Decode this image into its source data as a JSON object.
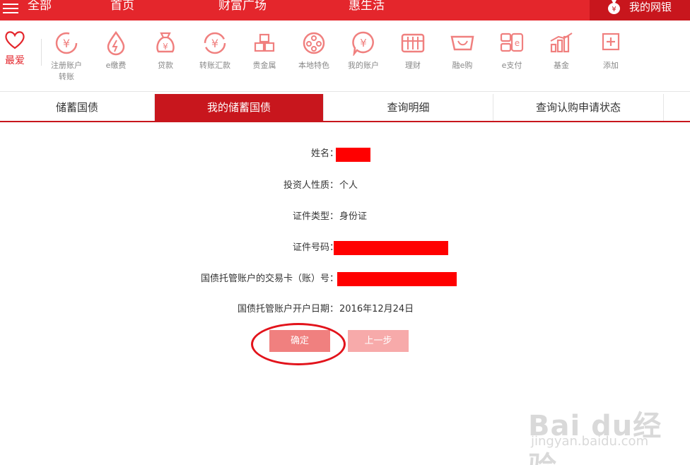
{
  "nav": {
    "all": "全部",
    "home": "首页",
    "wealth": "财富广场",
    "life": "惠生活",
    "mybank": "我的网银"
  },
  "toolbar": {
    "fav_label": "最爱",
    "items": [
      {
        "label": "注册账户\n转账",
        "icon": "register-transfer-icon"
      },
      {
        "label": "e缴费",
        "icon": "e-payment-icon"
      },
      {
        "label": "贷款",
        "icon": "loan-icon"
      },
      {
        "label": "转账汇款",
        "icon": "transfer-icon"
      },
      {
        "label": "贵金属",
        "icon": "precious-metal-icon"
      },
      {
        "label": "本地特色",
        "icon": "local-feature-icon"
      },
      {
        "label": "我的账户",
        "icon": "my-account-icon"
      },
      {
        "label": "理财",
        "icon": "wealth-management-icon"
      },
      {
        "label": "融e购",
        "icon": "e-shop-icon"
      },
      {
        "label": "e支付",
        "icon": "e-pay-icon"
      },
      {
        "label": "基金",
        "icon": "fund-icon"
      },
      {
        "label": "添加",
        "icon": "add-icon"
      }
    ]
  },
  "tabs": [
    {
      "label": "储蓄国债",
      "active": false
    },
    {
      "label": "我的储蓄国债",
      "active": true
    },
    {
      "label": "查询明细",
      "active": false
    },
    {
      "label": "查询认购申请状态",
      "active": false
    }
  ],
  "form": {
    "name_label": "姓名：",
    "investor_type_label": "投资人性质：",
    "investor_type_value": "个人",
    "id_type_label": "证件类型：",
    "id_type_value": "身份证",
    "id_number_label": "证件号码：",
    "trading_card_label": "国债托管账户的交易卡（账）号：",
    "open_date_label": "国债托管账户开户日期：",
    "open_date_value": "2016年12月24日"
  },
  "buttons": {
    "confirm": "确定",
    "previous": "上一步"
  },
  "watermark": {
    "brand": "Bai du经验",
    "url": "jingyan.baidu.com"
  },
  "colors": {
    "brand_red": "#e4262c",
    "dark_red": "#c8161d",
    "redaction": "#ff0000"
  }
}
